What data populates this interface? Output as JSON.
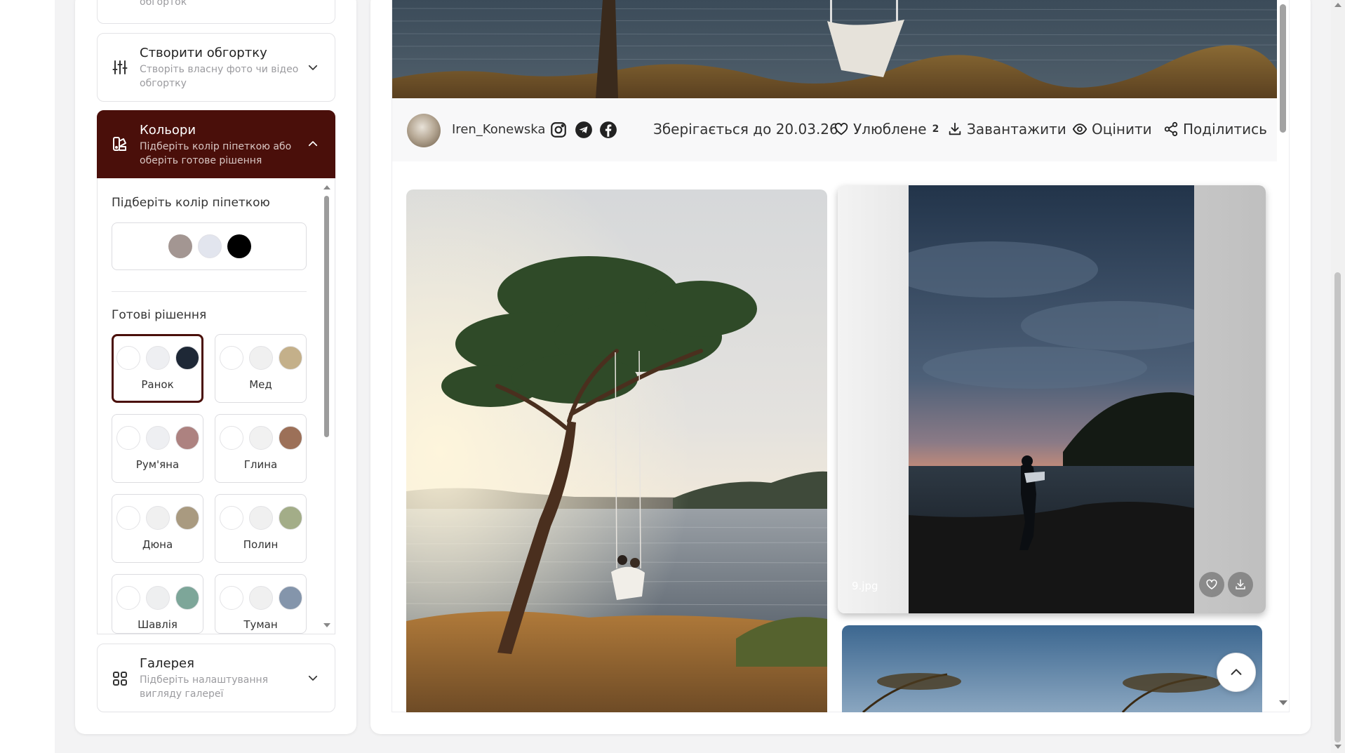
{
  "sidebar": {
    "top_item_sub": "обгорток",
    "create": {
      "title": "Створити обгортку",
      "subtitle": "Створіть власну фото чи відео обгортку"
    },
    "colors": {
      "title": "Кольори",
      "subtitle": "Підберіть колір піпеткою або оберіть готове рішення",
      "picker_label": "Підберіть колір піпеткою",
      "picker_colors": [
        "#a39692",
        "#e2e5ee",
        "#000000"
      ],
      "presets_label": "Готові рішення",
      "presets": [
        {
          "name": "Ранок",
          "colors": [
            "#ffffff",
            "#eeeff2",
            "#1e2836"
          ],
          "selected": true
        },
        {
          "name": "Мед",
          "colors": [
            "#ffffff",
            "#f0f0f0",
            "#c4b08a"
          ],
          "selected": false
        },
        {
          "name": "Рум'яна",
          "colors": [
            "#ffffff",
            "#eeeff2",
            "#ad8280"
          ],
          "selected": false
        },
        {
          "name": "Глина",
          "colors": [
            "#ffffff",
            "#f1f1f1",
            "#9c7058"
          ],
          "selected": false
        },
        {
          "name": "Дюна",
          "colors": [
            "#ffffff",
            "#f0f0f0",
            "#a99a80"
          ],
          "selected": false
        },
        {
          "name": "Полин",
          "colors": [
            "#ffffff",
            "#f0f0f0",
            "#a3ad88"
          ],
          "selected": false
        },
        {
          "name": "Шавлія",
          "colors": [
            "#ffffff",
            "#eeeff0",
            "#7da699"
          ],
          "selected": false
        },
        {
          "name": "Туман",
          "colors": [
            "#ffffff",
            "#f0f0f0",
            "#8495ab"
          ],
          "selected": false
        }
      ]
    },
    "gallery": {
      "title": "Галерея",
      "subtitle": "Підберіть налаштування вигляду галереї"
    }
  },
  "infobar": {
    "username": "Iren_Konewska",
    "social_icons": [
      "instagram-icon",
      "telegram-icon",
      "facebook-icon"
    ],
    "stored_until": "Зберігається до 20.03.26",
    "favorites_label": "Улюблене",
    "favorites_count": "2",
    "download_label": "Завантажити",
    "rate_label": "Оцінити",
    "share_label": "Поділитись"
  },
  "gallery": {
    "photo2_filename": "9.jpg"
  },
  "colors": {
    "accent": "#4a0f0a"
  }
}
